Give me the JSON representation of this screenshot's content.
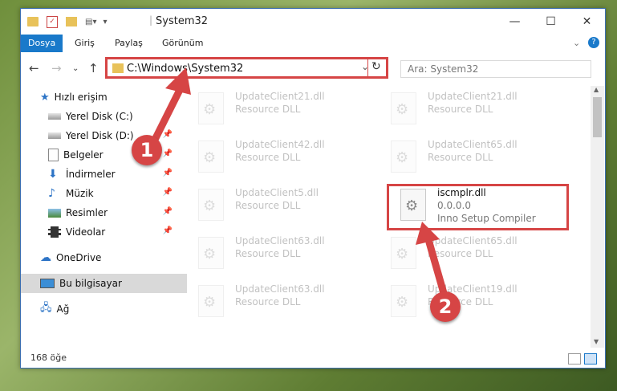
{
  "window": {
    "title": "System32"
  },
  "ribbon": {
    "tabs": [
      "Dosya",
      "Giriş",
      "Paylaş",
      "Görünüm"
    ]
  },
  "address": {
    "path": "C:\\Windows\\System32",
    "search_placeholder": "Ara: System32"
  },
  "nav": [
    {
      "label": "Hızlı erişim",
      "icon": "star-icon"
    },
    {
      "label": "Yerel Disk (C:)",
      "icon": "drive-icon"
    },
    {
      "label": "Yerel Disk (D:)",
      "icon": "drive-icon"
    },
    {
      "label": "Belgeler",
      "icon": "document-icon"
    },
    {
      "label": "İndirmeler",
      "icon": "download-icon"
    },
    {
      "label": "Müzik",
      "icon": "music-icon"
    },
    {
      "label": "Resimler",
      "icon": "pictures-icon"
    },
    {
      "label": "Videolar",
      "icon": "video-icon"
    },
    {
      "label": "OneDrive",
      "icon": "cloud-icon"
    },
    {
      "label": "Bu bilgisayar",
      "icon": "computer-icon"
    },
    {
      "label": "Ağ",
      "icon": "network-icon"
    }
  ],
  "files": [
    {
      "name": "UpdateClient21.dll",
      "sub": "Resource DLL"
    },
    {
      "name": "UpdateClient21.dll",
      "sub": "Resource DLL"
    },
    {
      "name": "UpdateClient42.dll",
      "sub": "Resource DLL"
    },
    {
      "name": "UpdateClient65.dll",
      "sub": "Resource DLL"
    },
    {
      "name": "UpdateClient5.dll",
      "sub": "Resource DLL"
    },
    {
      "name": "iscmplr.dll",
      "sub": "0.0.0.0",
      "sub2": "Inno Setup Compiler"
    },
    {
      "name": "UpdateClient63.dll",
      "sub": "Resource DLL"
    },
    {
      "name": "UpdateClient65.dll",
      "sub": "Resource DLL"
    },
    {
      "name": "UpdateClient63.dll",
      "sub": "Resource DLL"
    },
    {
      "name": "UpdateClient19.dll",
      "sub": "Resource DLL"
    }
  ],
  "status": {
    "count": "168 öğe"
  },
  "markers": [
    "1",
    "2"
  ],
  "colors": {
    "accent": "#1979ca",
    "highlight": "#d64545"
  }
}
